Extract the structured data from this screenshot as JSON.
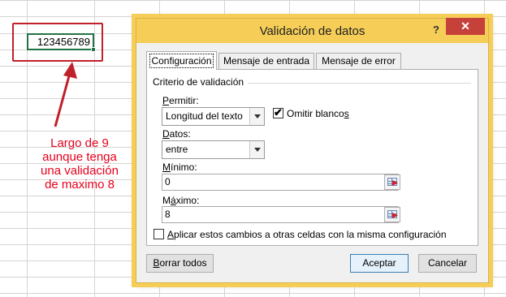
{
  "sheet": {
    "cell_value": "123456789"
  },
  "annotation": {
    "lines": [
      "Largo de 9",
      "aunque tenga",
      "una validación",
      "de maximo 8"
    ],
    "color": "#e8001c"
  },
  "dialog": {
    "title": "Validación de datos",
    "help_label": "?",
    "close_label": "✕",
    "tabs": [
      {
        "label": "Configuración",
        "active": true
      },
      {
        "label": "Mensaje de entrada",
        "active": false
      },
      {
        "label": "Mensaje de error",
        "active": false
      }
    ],
    "group_label": "Criterio de validación",
    "permitir": {
      "label_first": "P",
      "label_rest": "ermitir:",
      "value": "Longitud del texto"
    },
    "omitir_blancos": {
      "label_main": "Omitir blanco",
      "label_underlined": "s",
      "checked": true
    },
    "datos": {
      "label_first": "D",
      "label_rest": "atos:",
      "value": "entre"
    },
    "minimo": {
      "label_first": "M",
      "label_rest": "ínimo:",
      "value": "0"
    },
    "maximo": {
      "label_prefix": "M",
      "label_underlined": "á",
      "label_rest": "ximo:",
      "value": "8"
    },
    "apply_all": {
      "label_first": "A",
      "label_rest": "plicar estos cambios a otras celdas con la misma configuración",
      "checked": false
    },
    "buttons": {
      "clear_first": "B",
      "clear_rest": "orrar todos",
      "accept": "Aceptar",
      "cancel": "Cancelar"
    },
    "colors": {
      "title_bar": "#f5cd57",
      "close_button": "#c7413b",
      "selected_cell_border": "#217346",
      "annotation_box": "#c0202a"
    }
  }
}
